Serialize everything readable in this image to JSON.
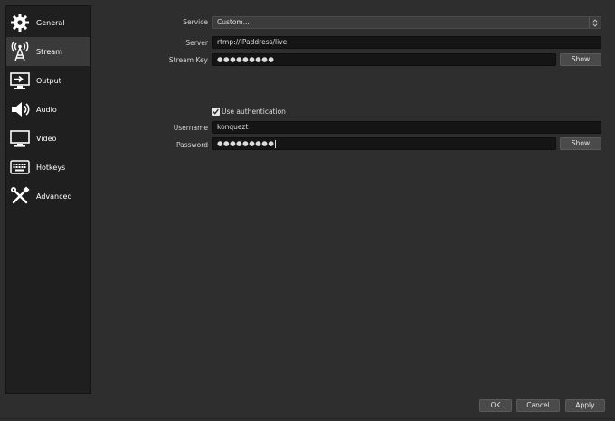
{
  "sidebar": {
    "items": [
      {
        "label": "General",
        "icon": "gear-icon"
      },
      {
        "label": "Stream",
        "icon": "broadcast-tower-icon",
        "selected": true
      },
      {
        "label": "Output",
        "icon": "output-monitor-icon"
      },
      {
        "label": "Audio",
        "icon": "speaker-icon"
      },
      {
        "label": "Video",
        "icon": "monitor-icon"
      },
      {
        "label": "Hotkeys",
        "icon": "keyboard-icon"
      },
      {
        "label": "Advanced",
        "icon": "wrench-screwdriver-icon"
      }
    ]
  },
  "stream": {
    "service_label": "Service",
    "service_value": "Custom...",
    "server_label": "Server",
    "server_value": "rtmp://IPaddress/live",
    "streamkey_label": "Stream Key",
    "streamkey_value": "●●●●●●●●●",
    "show_label": "Show",
    "use_auth_label": "Use authentication",
    "use_auth_checked": true,
    "username_label": "Username",
    "username_value": "konquezt",
    "password_label": "Password",
    "password_value": "●●●●●●●●●",
    "password_show_label": "Show"
  },
  "buttons": {
    "ok": "OK",
    "cancel": "Cancel",
    "apply": "Apply"
  },
  "colors": {
    "background": "#2e2e2e",
    "sidebar": "#1f1f1f",
    "selected": "#3a3a3a",
    "field": "#151515"
  }
}
